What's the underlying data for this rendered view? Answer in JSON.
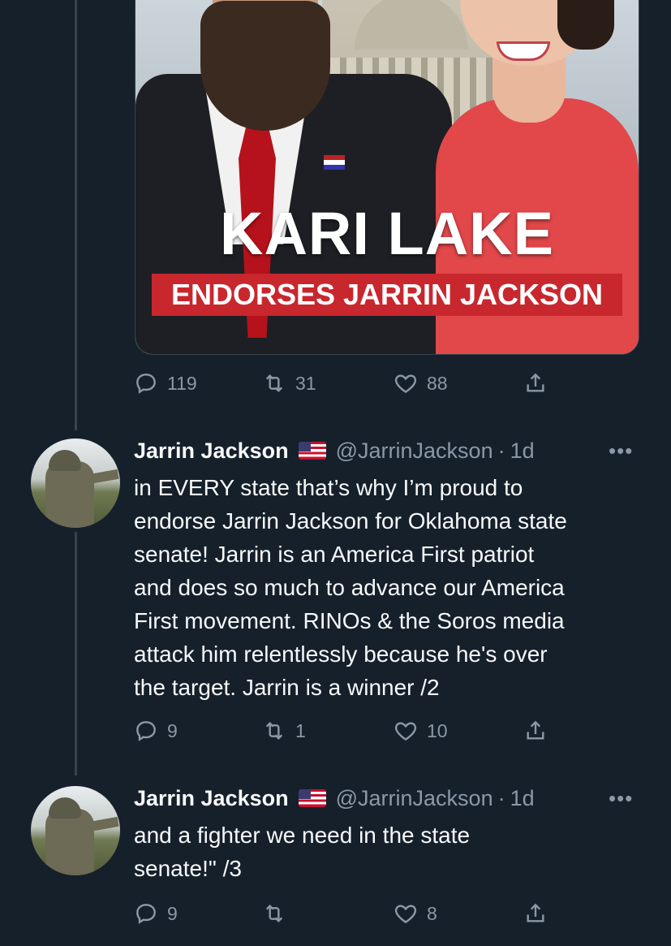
{
  "media": {
    "headline": "KARI LAKE",
    "subhead": "ENDORSES JARRIN JACKSON"
  },
  "tweet1_actions": {
    "replies": "119",
    "retweets": "31",
    "likes": "88"
  },
  "tweet2": {
    "name": "Jarrin Jackson",
    "handle": "@JarrinJackson",
    "separator": "·",
    "time": "1d",
    "more": "•••",
    "text": "in EVERY state that’s why I’m proud to\nendorse Jarrin Jackson for Oklahoma state\nsenate! Jarrin is an America First patriot\nand does so much to advance our America\nFirst movement. RINOs & the Soros media\nattack him relentlessly because he's over\nthe target. Jarrin is a winner /2",
    "replies": "9",
    "retweets": "1",
    "likes": "10"
  },
  "tweet3": {
    "name": "Jarrin Jackson",
    "handle": "@JarrinJackson",
    "separator": "·",
    "time": "1d",
    "more": "•••",
    "text": "and a fighter we need in the state\nsenate!\" /3",
    "replies": "9",
    "retweets": "",
    "likes": "8"
  },
  "icons": {
    "reply": "reply-icon",
    "retweet": "retweet-icon",
    "like": "heart-icon",
    "share": "share-icon",
    "flag": "us-flag-icon"
  },
  "colors": {
    "background": "#15202b",
    "muted": "#8b98a5",
    "text": "#f7f9f9",
    "banner_red": "#c8272e"
  }
}
